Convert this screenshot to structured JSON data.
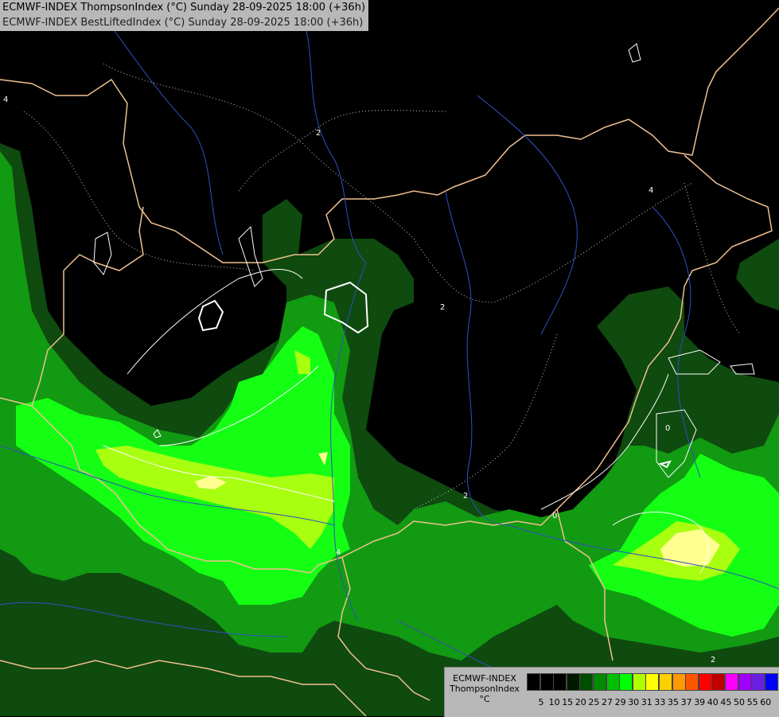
{
  "header": {
    "line1": "ECMWF-INDEX ThompsonIndex (°C) Sunday 28-09-2025 18:00 (+36h)",
    "line2": "ECMWF-INDEX BestLiftedIndex (°C) Sunday 28-09-2025 18:00 (+36h)"
  },
  "legend": {
    "model": "ECMWF-INDEX",
    "parameter": "ThompsonIndex",
    "unit": "°C",
    "ticks": [
      "5",
      "10",
      "15",
      "20",
      "25",
      "27",
      "29",
      "30",
      "31",
      "33",
      "35",
      "37",
      "39",
      "40",
      "45",
      "50",
      "55",
      "60"
    ],
    "colors": [
      "#000000",
      "#000000",
      "#000000",
      "#001a00",
      "#004d00",
      "#008a00",
      "#00c000",
      "#00ff00",
      "#b0ff00",
      "#ffff00",
      "#ffd000",
      "#ff9900",
      "#ff5500",
      "#ff0000",
      "#c00000",
      "#ff00ff",
      "#a000ff",
      "#6a1fe0",
      "#0000ff"
    ]
  },
  "contour_labels": [
    "4",
    "2",
    "4",
    "2",
    "0",
    "0",
    "4",
    "2",
    "2"
  ],
  "colors": {
    "background": "#000000",
    "borders": "#f0c090",
    "rivers": "#3050c0",
    "lifted_index": "#ffffff"
  }
}
